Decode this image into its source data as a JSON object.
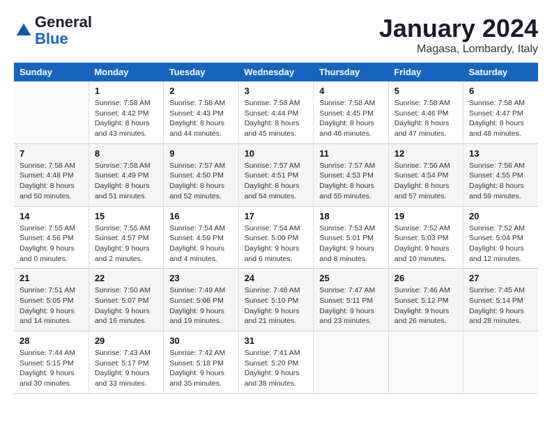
{
  "header": {
    "logo_line1": "General",
    "logo_line2": "Blue",
    "month": "January 2024",
    "location": "Magasa, Lombardy, Italy"
  },
  "weekdays": [
    "Sunday",
    "Monday",
    "Tuesday",
    "Wednesday",
    "Thursday",
    "Friday",
    "Saturday"
  ],
  "weeks": [
    [
      {
        "day": "",
        "info": ""
      },
      {
        "day": "1",
        "info": "Sunrise: 7:58 AM\nSunset: 4:42 PM\nDaylight: 8 hours\nand 43 minutes."
      },
      {
        "day": "2",
        "info": "Sunrise: 7:58 AM\nSunset: 4:43 PM\nDaylight: 8 hours\nand 44 minutes."
      },
      {
        "day": "3",
        "info": "Sunrise: 7:58 AM\nSunset: 4:44 PM\nDaylight: 8 hours\nand 45 minutes."
      },
      {
        "day": "4",
        "info": "Sunrise: 7:58 AM\nSunset: 4:45 PM\nDaylight: 8 hours\nand 46 minutes."
      },
      {
        "day": "5",
        "info": "Sunrise: 7:58 AM\nSunset: 4:46 PM\nDaylight: 8 hours\nand 47 minutes."
      },
      {
        "day": "6",
        "info": "Sunrise: 7:58 AM\nSunset: 4:47 PM\nDaylight: 8 hours\nand 48 minutes."
      }
    ],
    [
      {
        "day": "7",
        "info": "Sunrise: 7:58 AM\nSunset: 4:48 PM\nDaylight: 8 hours\nand 50 minutes."
      },
      {
        "day": "8",
        "info": "Sunrise: 7:58 AM\nSunset: 4:49 PM\nDaylight: 8 hours\nand 51 minutes."
      },
      {
        "day": "9",
        "info": "Sunrise: 7:57 AM\nSunset: 4:50 PM\nDaylight: 8 hours\nand 52 minutes."
      },
      {
        "day": "10",
        "info": "Sunrise: 7:57 AM\nSunset: 4:51 PM\nDaylight: 8 hours\nand 54 minutes."
      },
      {
        "day": "11",
        "info": "Sunrise: 7:57 AM\nSunset: 4:53 PM\nDaylight: 8 hours\nand 55 minutes."
      },
      {
        "day": "12",
        "info": "Sunrise: 7:56 AM\nSunset: 4:54 PM\nDaylight: 8 hours\nand 57 minutes."
      },
      {
        "day": "13",
        "info": "Sunrise: 7:56 AM\nSunset: 4:55 PM\nDaylight: 8 hours\nand 59 minutes."
      }
    ],
    [
      {
        "day": "14",
        "info": "Sunrise: 7:55 AM\nSunset: 4:56 PM\nDaylight: 9 hours\nand 0 minutes."
      },
      {
        "day": "15",
        "info": "Sunrise: 7:55 AM\nSunset: 4:57 PM\nDaylight: 9 hours\nand 2 minutes."
      },
      {
        "day": "16",
        "info": "Sunrise: 7:54 AM\nSunset: 4:59 PM\nDaylight: 9 hours\nand 4 minutes."
      },
      {
        "day": "17",
        "info": "Sunrise: 7:54 AM\nSunset: 5:00 PM\nDaylight: 9 hours\nand 6 minutes."
      },
      {
        "day": "18",
        "info": "Sunrise: 7:53 AM\nSunset: 5:01 PM\nDaylight: 9 hours\nand 8 minutes."
      },
      {
        "day": "19",
        "info": "Sunrise: 7:52 AM\nSunset: 5:03 PM\nDaylight: 9 hours\nand 10 minutes."
      },
      {
        "day": "20",
        "info": "Sunrise: 7:52 AM\nSunset: 5:04 PM\nDaylight: 9 hours\nand 12 minutes."
      }
    ],
    [
      {
        "day": "21",
        "info": "Sunrise: 7:51 AM\nSunset: 5:05 PM\nDaylight: 9 hours\nand 14 minutes."
      },
      {
        "day": "22",
        "info": "Sunrise: 7:50 AM\nSunset: 5:07 PM\nDaylight: 9 hours\nand 16 minutes."
      },
      {
        "day": "23",
        "info": "Sunrise: 7:49 AM\nSunset: 5:08 PM\nDaylight: 9 hours\nand 19 minutes."
      },
      {
        "day": "24",
        "info": "Sunrise: 7:48 AM\nSunset: 5:10 PM\nDaylight: 9 hours\nand 21 minutes."
      },
      {
        "day": "25",
        "info": "Sunrise: 7:47 AM\nSunset: 5:11 PM\nDaylight: 9 hours\nand 23 minutes."
      },
      {
        "day": "26",
        "info": "Sunrise: 7:46 AM\nSunset: 5:12 PM\nDaylight: 9 hours\nand 26 minutes."
      },
      {
        "day": "27",
        "info": "Sunrise: 7:45 AM\nSunset: 5:14 PM\nDaylight: 9 hours\nand 28 minutes."
      }
    ],
    [
      {
        "day": "28",
        "info": "Sunrise: 7:44 AM\nSunset: 5:15 PM\nDaylight: 9 hours\nand 30 minutes."
      },
      {
        "day": "29",
        "info": "Sunrise: 7:43 AM\nSunset: 5:17 PM\nDaylight: 9 hours\nand 33 minutes."
      },
      {
        "day": "30",
        "info": "Sunrise: 7:42 AM\nSunset: 5:18 PM\nDaylight: 9 hours\nand 35 minutes."
      },
      {
        "day": "31",
        "info": "Sunrise: 7:41 AM\nSunset: 5:20 PM\nDaylight: 9 hours\nand 38 minutes."
      },
      {
        "day": "",
        "info": ""
      },
      {
        "day": "",
        "info": ""
      },
      {
        "day": "",
        "info": ""
      }
    ]
  ]
}
